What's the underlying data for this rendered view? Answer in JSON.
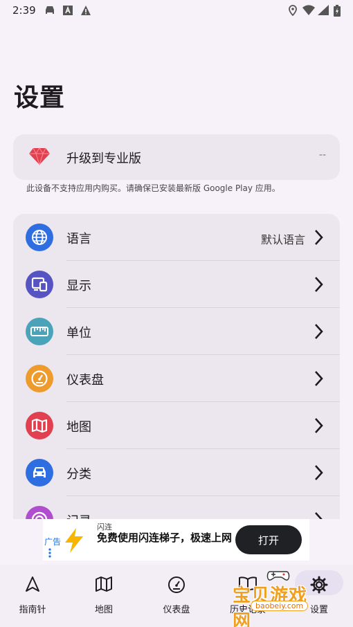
{
  "status_bar": {
    "time": "2:39"
  },
  "page_title": "设置",
  "upgrade": {
    "label": "升级到专业版",
    "value": "--",
    "note": "此设备不支持应用内购买。请确保已安装最新版 Google Play 应用。"
  },
  "settings": {
    "items": [
      {
        "label": "语言",
        "value": "默认语言",
        "icon": "globe-icon",
        "color": "#2f6ee0"
      },
      {
        "label": "显示",
        "value": "",
        "icon": "display-icon",
        "color": "#5653c2"
      },
      {
        "label": "单位",
        "value": "",
        "icon": "ruler-icon",
        "color": "#4aa3b8"
      },
      {
        "label": "仪表盘",
        "value": "",
        "icon": "gauge-icon",
        "color": "#ee9b2d"
      },
      {
        "label": "地图",
        "value": "",
        "icon": "map-icon",
        "color": "#e0404f"
      },
      {
        "label": "分类",
        "value": "",
        "icon": "car-icon",
        "color": "#2f6ee0"
      },
      {
        "label": "记录",
        "value": "",
        "icon": "record-icon",
        "color": "#b14ed0"
      }
    ]
  },
  "ad": {
    "tag": "广告",
    "brand": "闪连",
    "text": "免费使用闪连梯子，极速上网",
    "button": "打开"
  },
  "bottom_nav": {
    "items": [
      {
        "label": "指南针",
        "icon": "compass-icon"
      },
      {
        "label": "地图",
        "icon": "map-icon"
      },
      {
        "label": "仪表盘",
        "icon": "gauge-icon"
      },
      {
        "label": "历史记录",
        "icon": "book-icon"
      },
      {
        "label": "设置",
        "icon": "gear-icon"
      }
    ],
    "active": "设置"
  },
  "watermark": {
    "text": "宝贝游戏网",
    "url": "baobeiy.com"
  }
}
